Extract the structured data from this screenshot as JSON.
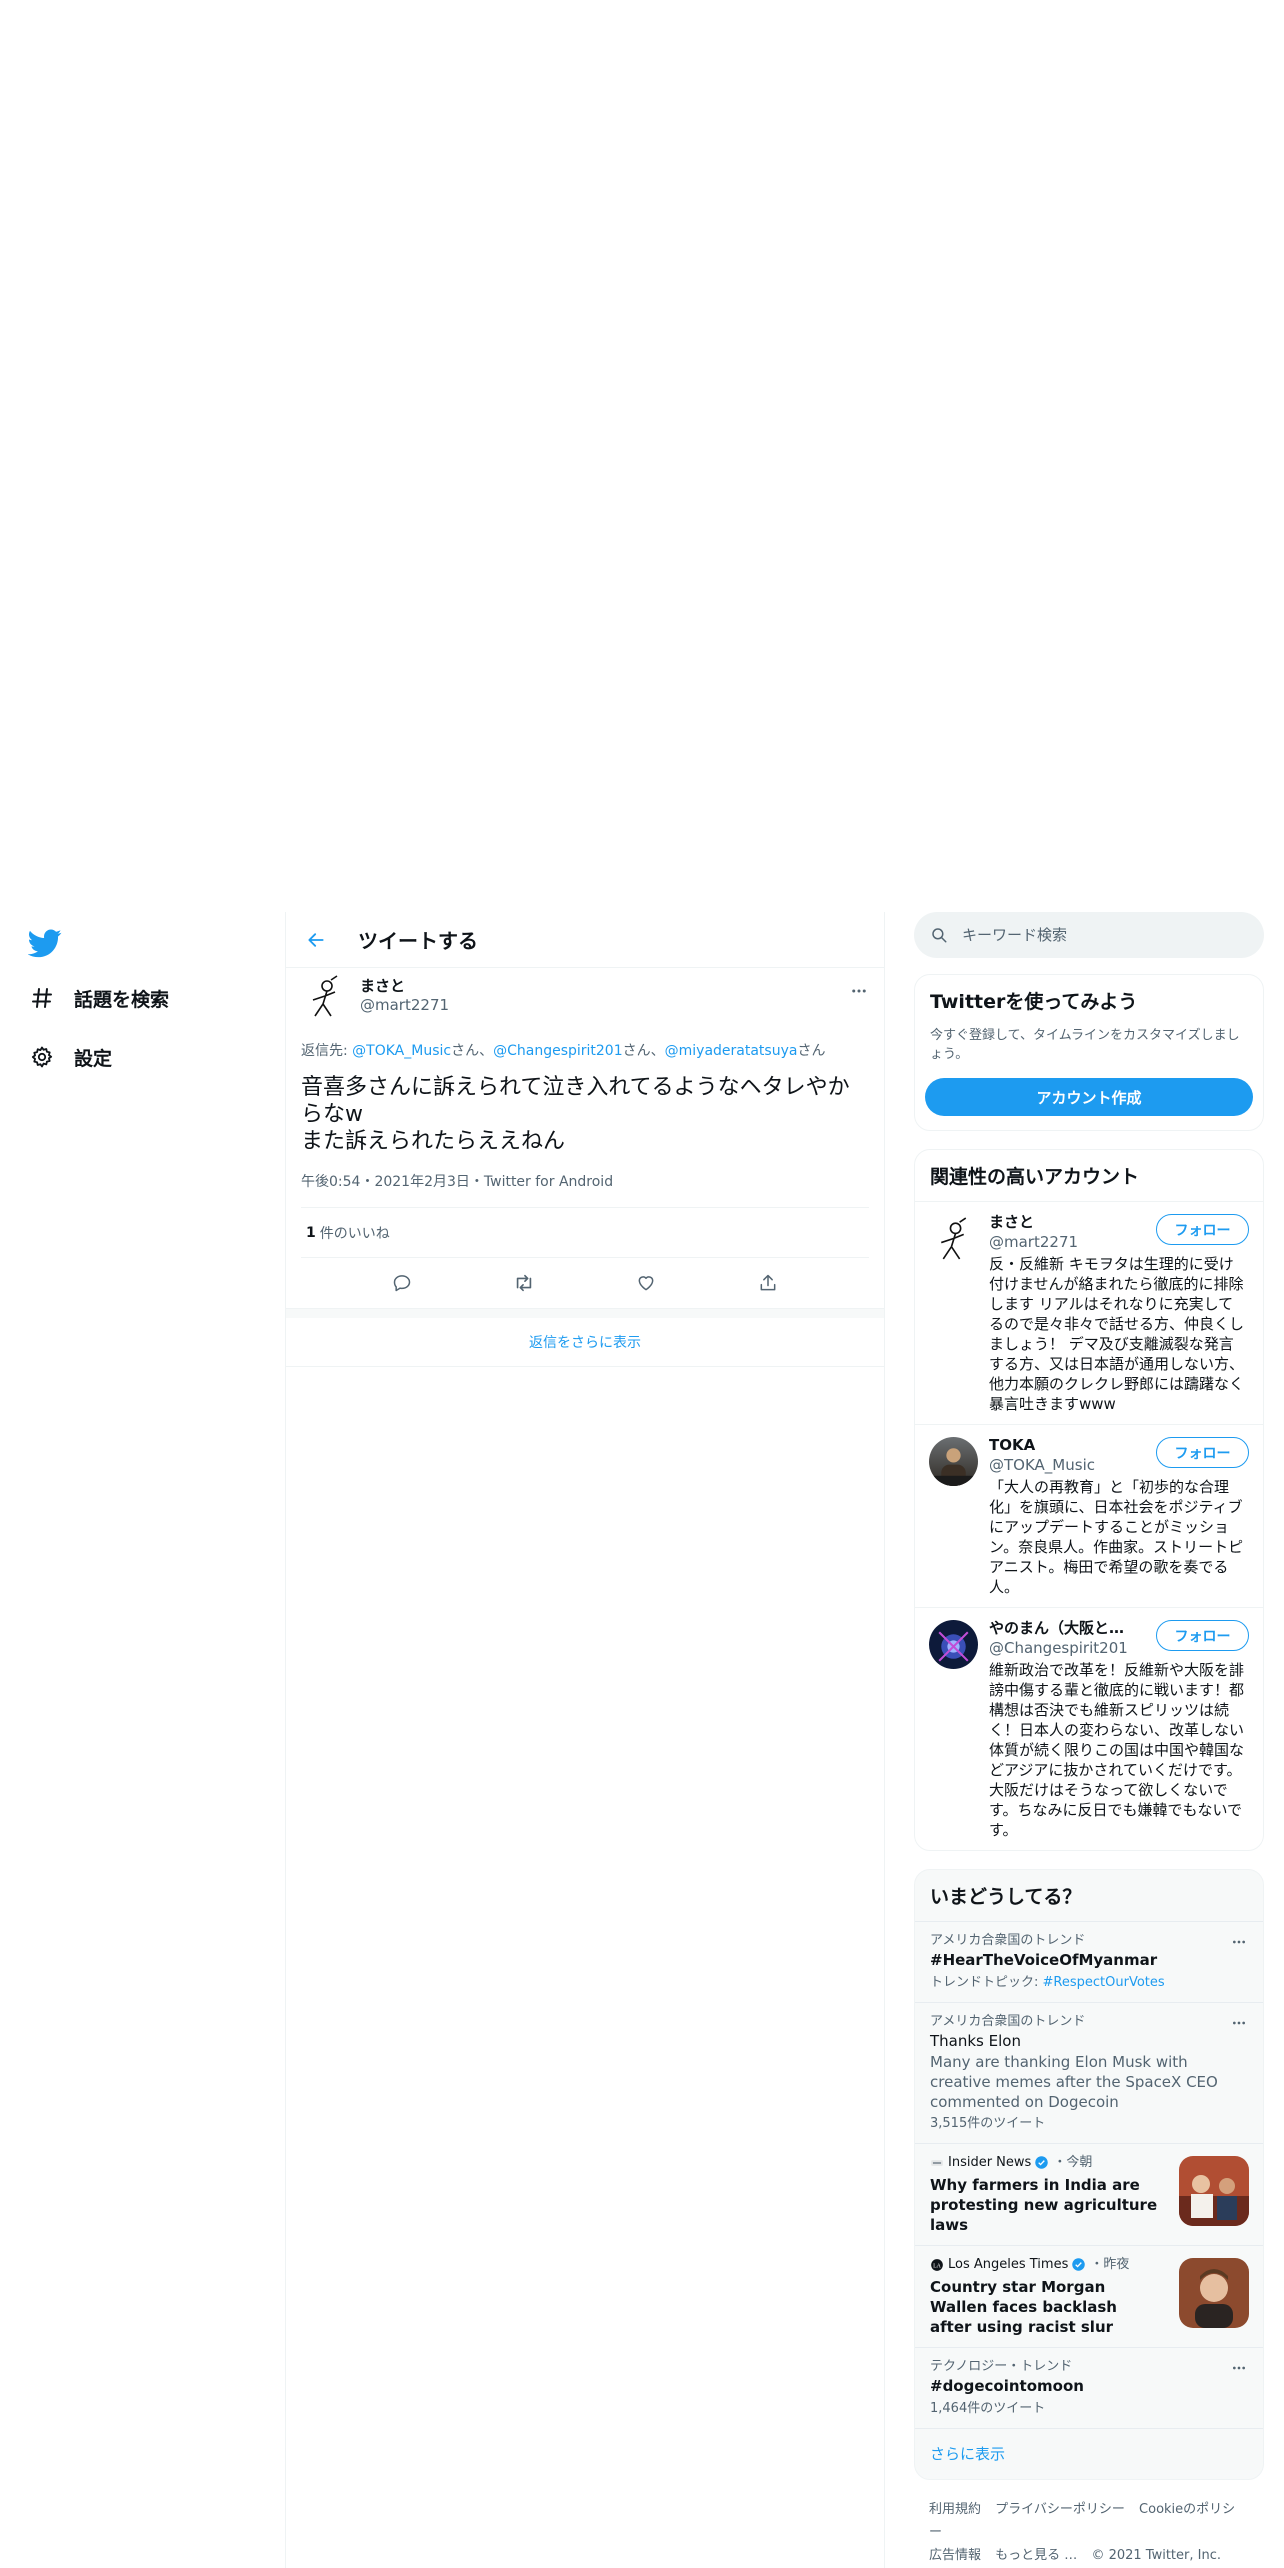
{
  "nav": {
    "items": [
      {
        "label": "話題を検索",
        "icon": "hashtag-icon"
      },
      {
        "label": "設定",
        "icon": "gear-icon"
      }
    ]
  },
  "header": {
    "title": "ツイートする"
  },
  "tweet": {
    "display_name": "まさと",
    "handle": "@mart2271",
    "reply_prefix": "返信先: ",
    "reply_to": [
      "@TOKA_Music",
      "@Changespirit201",
      "@miyaderatatsuya"
    ],
    "reply_suffix": "さん",
    "reply_sep": "、",
    "text": "音喜多さんに訴えられて泣き入れてるようなヘタレやからなw\nまた訴えられたらええねん",
    "meta": "午後0:54・2021年2月3日・Twitter for Android",
    "likes_count": "1",
    "likes_label": "件のいいね",
    "show_replies": "返信をさらに表示"
  },
  "sidebar": {
    "search_placeholder": "キーワード検索",
    "signup": {
      "title": "Twitterを使ってみよう",
      "desc": "今すぐ登録して、タイムラインをカスタマイズしましょう。",
      "button": "アカウント作成"
    },
    "related": {
      "title": "関連性の高いアカウント",
      "follow_label": "フォロー",
      "accounts": [
        {
          "name": "まさと",
          "handle": "@mart2271",
          "bio": "反・反維新 キモヲタは生理的に受け付けませんが絡まれたら徹底的に排除します リアルはそれなりに充実してるので是々非々で話せる方、仲良くしましょう！ デマ及び支離滅裂な発言する方、又は日本語が通用しない方、他力本願のクレクレ野郎には躊躇なく暴言吐きますwww"
        },
        {
          "name": "TOKA",
          "handle": "@TOKA_Music",
          "bio": "「大人の再教育」と「初歩的な合理化」を旗頭に、日本社会をポジティブにアップデートすることがミッション。奈良県人。作曲家。ストリートピアニスト。梅田で希望の歌を奏でる人。"
        },
        {
          "name": "やのまん（大阪と維新を応援）",
          "handle": "@Changespirit201",
          "bio": "維新政治で改革を！反維新や大阪を誹謗中傷する輩と徹底的に戦います！都構想は否決でも維新スピリッツは続く！日本人の変わらない、改革しない体質が続く限りこの国は中国や韓国などアジアに抜かされていくだけです。大阪だけはそうなって欲しくないです。ちなみに反日でも嫌韓でもないです。"
        }
      ]
    },
    "trends": {
      "title": "いまどうしてる？",
      "items": [
        {
          "kind": "trend",
          "context": "アメリカ合衆国のトレンド",
          "name": "#HearTheVoiceOfMyanmar",
          "sub_prefix": "トレンドトピック: ",
          "sub_link": "#RespectOurVotes"
        },
        {
          "kind": "trend",
          "context": "アメリカ合衆国のトレンド",
          "name": "Thanks Elon",
          "desc": "Many are thanking Elon Musk with creative memes after the SpaceX CEO commented on Dogecoin",
          "count": "3,515件のツイート"
        },
        {
          "kind": "news",
          "source": "Insider News",
          "time": "今朝",
          "headline": "Why farmers in India are protesting new agriculture laws"
        },
        {
          "kind": "news",
          "source": "Los Angeles Times",
          "time": "昨夜",
          "headline": "Country star Morgan Wallen faces backlash after using racist slur"
        },
        {
          "kind": "trend",
          "context": "テクノロジー・トレンド",
          "name": "#dogecointomoon",
          "count": "1,464件のツイート"
        }
      ],
      "show_more": "さらに表示"
    },
    "footer": {
      "links": [
        "利用規約",
        "プライバシーポリシー",
        "Cookieのポリシー",
        "広告情報",
        "もっと見る …"
      ],
      "copyright": "© 2021 Twitter, Inc."
    }
  },
  "colors": {
    "accent": "#1d9bf0",
    "text": "#0f1419",
    "secondary": "#536471",
    "border": "#eff3f4"
  }
}
